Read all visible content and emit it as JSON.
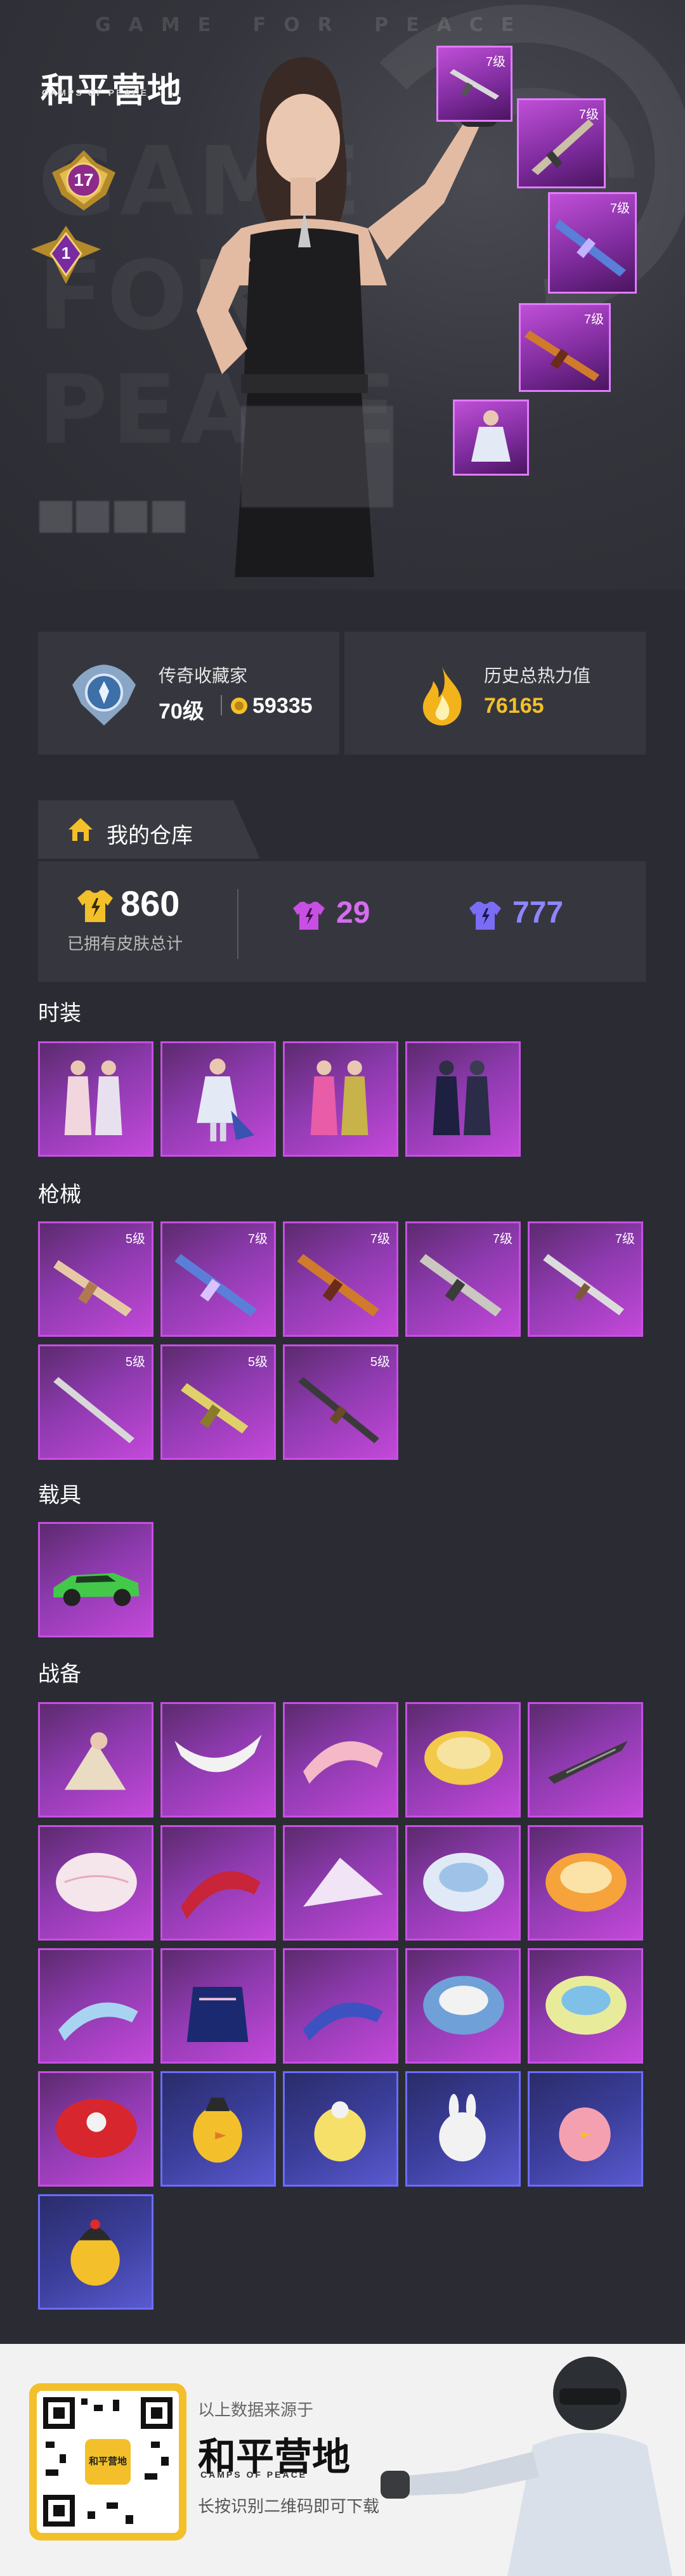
{
  "hero": {
    "bg_text": "GAME FOR PEACE",
    "bg_big_1": "GAME",
    "bg_big_2": "FOR",
    "bg_big_3": "PEACE",
    "logo_title": "和平营地",
    "logo_subtitle": "CAMPS OF PEACE",
    "rank_level": "17",
    "tier_level": "1",
    "featured_items": [
      {
        "level": "7级",
        "icon": "rifle-icon"
      },
      {
        "level": "7级",
        "icon": "rifle-icon"
      },
      {
        "level": "7级",
        "icon": "rifle-icon"
      },
      {
        "level": "7级",
        "icon": "rifle-icon"
      },
      {
        "level": "",
        "icon": "outfit-icon"
      }
    ]
  },
  "stats": {
    "collector_title": "传奇收藏家",
    "collector_level": "70级",
    "collector_points": "59335",
    "heat_title": "历史总热力值",
    "heat_value": "76165"
  },
  "warehouse": {
    "title": "我的仓库",
    "total_count": "860",
    "total_label": "已拥有皮肤总计",
    "purple_count": "29",
    "blue_count": "777"
  },
  "sections": {
    "fashion": {
      "title": "时装",
      "items": [
        {
          "level": ""
        },
        {
          "level": ""
        },
        {
          "level": ""
        },
        {
          "level": ""
        }
      ]
    },
    "weapons": {
      "title": "枪械",
      "items": [
        {
          "level": "5级"
        },
        {
          "level": "7级"
        },
        {
          "level": "7级"
        },
        {
          "level": "7级"
        },
        {
          "level": "7级"
        },
        {
          "level": "5级"
        },
        {
          "level": "5级"
        },
        {
          "level": "5级"
        }
      ]
    },
    "vehicles": {
      "title": "载具",
      "items": [
        {
          "level": ""
        }
      ]
    },
    "equipment": {
      "title": "战备",
      "items_count": 21
    }
  },
  "footer": {
    "source_text": "以上数据来源于",
    "brand": "和平营地",
    "brand_sub": "CAMPS OF PEACE",
    "qr_label": "和平营地",
    "scan_text": "长按识别二维码即可下载"
  },
  "colors": {
    "accent_gold": "#f3c02b",
    "purple": "#c74fe3",
    "blue": "#6a6dff",
    "background": "#2b2c33",
    "panel": "#36373e"
  }
}
